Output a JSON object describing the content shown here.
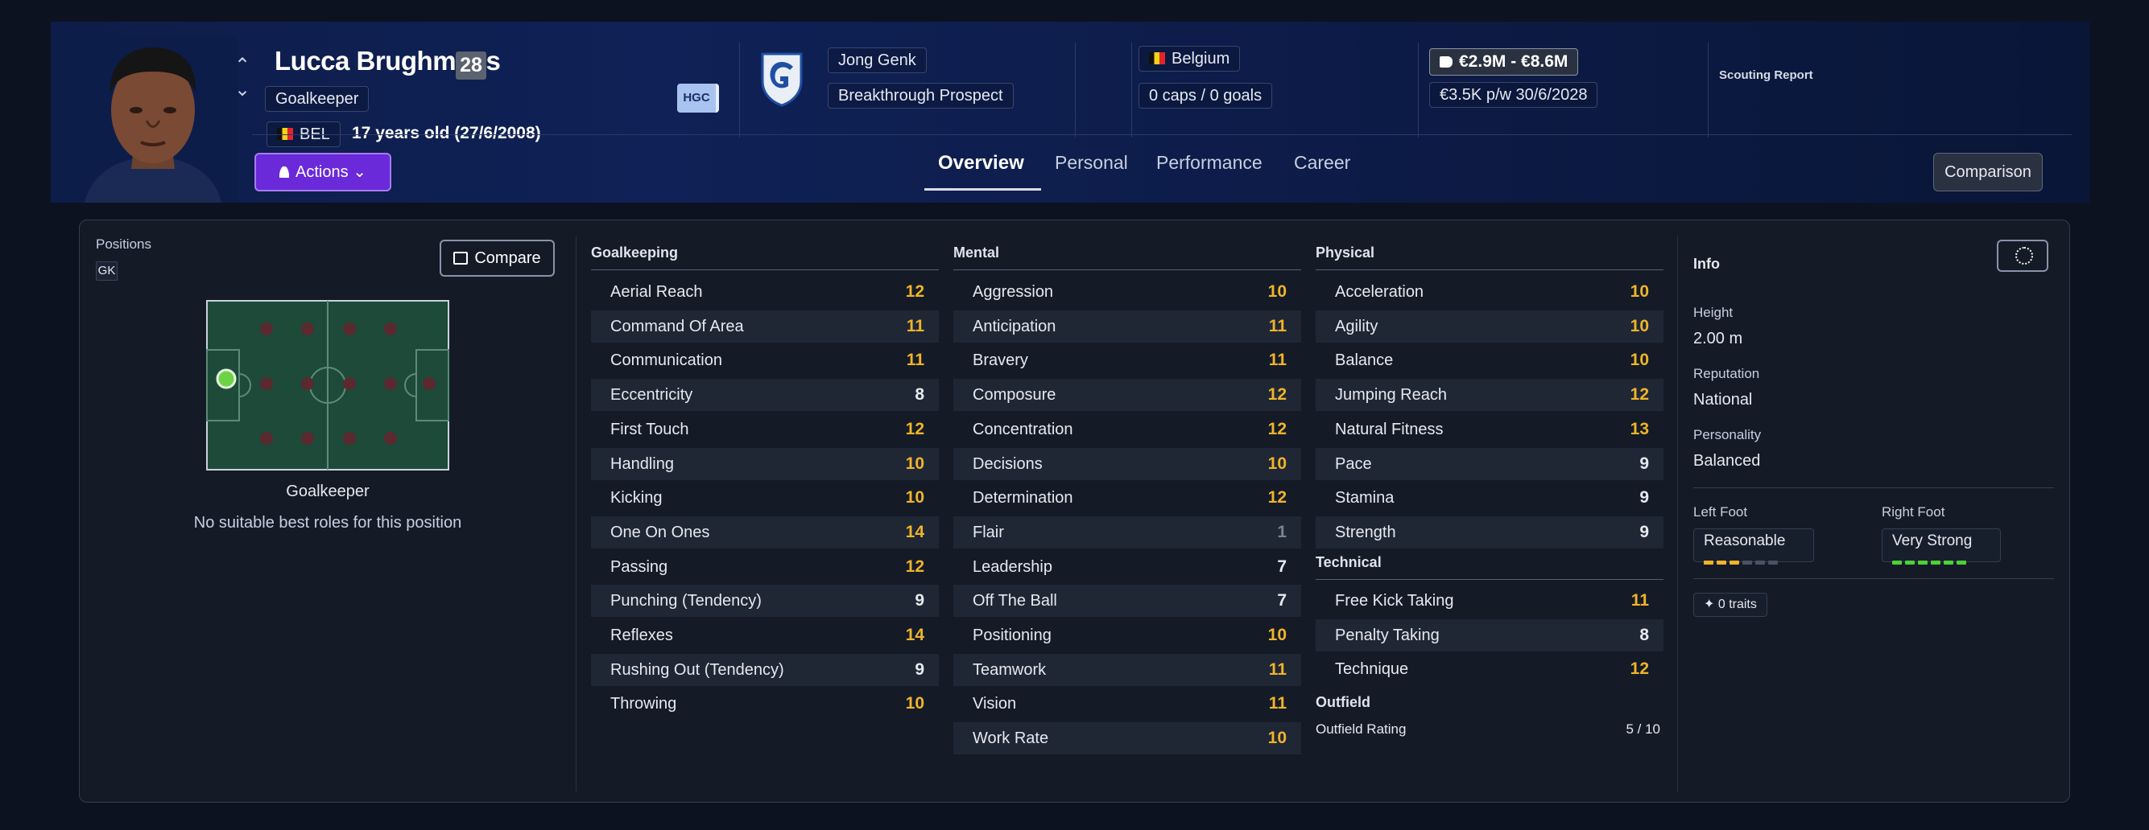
{
  "header": {
    "player_name": "Lucca Brughmans",
    "age_badge": "28",
    "position": "Goalkeeper",
    "nationality_code": "BEL",
    "age_text": "17 years old (27/6/2008)",
    "hgc": "HGC",
    "club": "Jong Genk",
    "club_status": "Breakthrough Prospect",
    "country": "Belgium",
    "caps": "0 caps / 0 goals",
    "value_range": "€2.9M - €8.6M",
    "wage_contract": "€3.5K p/w 30/6/2028",
    "scouting_report": "Scouting Report",
    "actions_label": "Actions",
    "comparison_label": "Comparison",
    "tabs": [
      {
        "label": "Overview",
        "active": true
      },
      {
        "label": "Personal",
        "active": false
      },
      {
        "label": "Performance",
        "active": false
      },
      {
        "label": "Career",
        "active": false
      }
    ]
  },
  "positions": {
    "label": "Positions",
    "chip": "GK",
    "compare_label": "Compare",
    "pitch_title": "Goalkeeper",
    "pitch_subtitle": "No suitable best roles for this position"
  },
  "goalkeeping": {
    "title": "Goalkeeping",
    "attributes": [
      {
        "name": "Aerial Reach",
        "value": 12
      },
      {
        "name": "Command Of Area",
        "value": 11
      },
      {
        "name": "Communication",
        "value": 11
      },
      {
        "name": "Eccentricity",
        "value": 8
      },
      {
        "name": "First Touch",
        "value": 12
      },
      {
        "name": "Handling",
        "value": 10
      },
      {
        "name": "Kicking",
        "value": 10
      },
      {
        "name": "One On Ones",
        "value": 14
      },
      {
        "name": "Passing",
        "value": 12
      },
      {
        "name": "Punching (Tendency)",
        "value": 9
      },
      {
        "name": "Reflexes",
        "value": 14
      },
      {
        "name": "Rushing Out (Tendency)",
        "value": 9
      },
      {
        "name": "Throwing",
        "value": 10
      }
    ]
  },
  "mental": {
    "title": "Mental",
    "attributes": [
      {
        "name": "Aggression",
        "value": 10
      },
      {
        "name": "Anticipation",
        "value": 11
      },
      {
        "name": "Bravery",
        "value": 11
      },
      {
        "name": "Composure",
        "value": 12
      },
      {
        "name": "Concentration",
        "value": 12
      },
      {
        "name": "Decisions",
        "value": 10
      },
      {
        "name": "Determination",
        "value": 12
      },
      {
        "name": "Flair",
        "value": 1
      },
      {
        "name": "Leadership",
        "value": 7
      },
      {
        "name": "Off The Ball",
        "value": 7
      },
      {
        "name": "Positioning",
        "value": 10
      },
      {
        "name": "Teamwork",
        "value": 11
      },
      {
        "name": "Vision",
        "value": 11
      },
      {
        "name": "Work Rate",
        "value": 10
      }
    ]
  },
  "physical": {
    "title": "Physical",
    "attributes": [
      {
        "name": "Acceleration",
        "value": 10
      },
      {
        "name": "Agility",
        "value": 10
      },
      {
        "name": "Balance",
        "value": 10
      },
      {
        "name": "Jumping Reach",
        "value": 12
      },
      {
        "name": "Natural Fitness",
        "value": 13
      },
      {
        "name": "Pace",
        "value": 9
      },
      {
        "name": "Stamina",
        "value": 9
      },
      {
        "name": "Strength",
        "value": 9
      }
    ]
  },
  "technical": {
    "title": "Technical",
    "attributes": [
      {
        "name": "Free Kick Taking",
        "value": 11
      },
      {
        "name": "Penalty Taking",
        "value": 8
      },
      {
        "name": "Technique",
        "value": 12
      }
    ]
  },
  "outfield": {
    "title": "Outfield",
    "rating_label": "Outfield Rating",
    "rating_value": "5 / 10"
  },
  "info": {
    "title": "Info",
    "height_label": "Height",
    "height": "2.00 m",
    "reputation_label": "Reputation",
    "reputation": "National",
    "personality_label": "Personality",
    "personality": "Balanced",
    "left_foot_label": "Left Foot",
    "left_foot": "Reasonable",
    "left_foot_level": 3,
    "right_foot_label": "Right Foot",
    "right_foot": "Very Strong",
    "right_foot_level": 6,
    "traits": "0 traits"
  },
  "colors": {
    "high_value": "#f0b429",
    "low_value": "#7a8190",
    "foot_weak_fill": "#f0b429",
    "foot_strong_fill": "#4cd137",
    "actions_purple": "#6a2ad9"
  }
}
